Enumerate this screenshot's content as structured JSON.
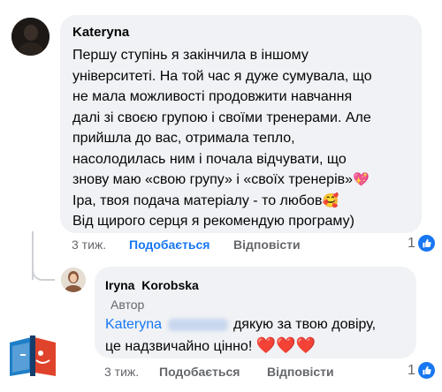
{
  "comment": {
    "author": "Kateryna",
    "lines": [
      "Першу ступінь я закінчила в іншому",
      "університеті. На той час я дуже сумувала, що",
      "не мала можливості продовжити навчання",
      "далі зі своєю групою і своїми тренерами. Але",
      "прийшла до вас, отримала тепло,",
      "насолодилась ним і почала відчувати, що",
      "знову маю «свою групу» і «своїх тренерів»",
      "Іра, твоя подача матеріалу - то любов",
      "Від щирого серця я рекомендую програму)"
    ],
    "emoji_sparkle_heart": "💖",
    "emoji_smile_hearts": "🥰",
    "time": "3 тиж.",
    "like_label": "Подобається",
    "reply_label": "Відповісти",
    "reaction_count": "1"
  },
  "reply": {
    "author": "Iryna  Korobska",
    "badge": "Автор",
    "mention": "Kateryna",
    "text_line1": "дякую за твою довіру,",
    "text_line2": "це надзвичайно цінно!",
    "hearts": "❤️❤️❤️",
    "time": "3 тиж.",
    "like_label": "Подобається",
    "reply_label": "Відповісти",
    "reaction_count": "1"
  },
  "colors": {
    "bubble": "#f0f2f5",
    "link_blue": "#1877f2",
    "meta_gray": "#65676b"
  }
}
